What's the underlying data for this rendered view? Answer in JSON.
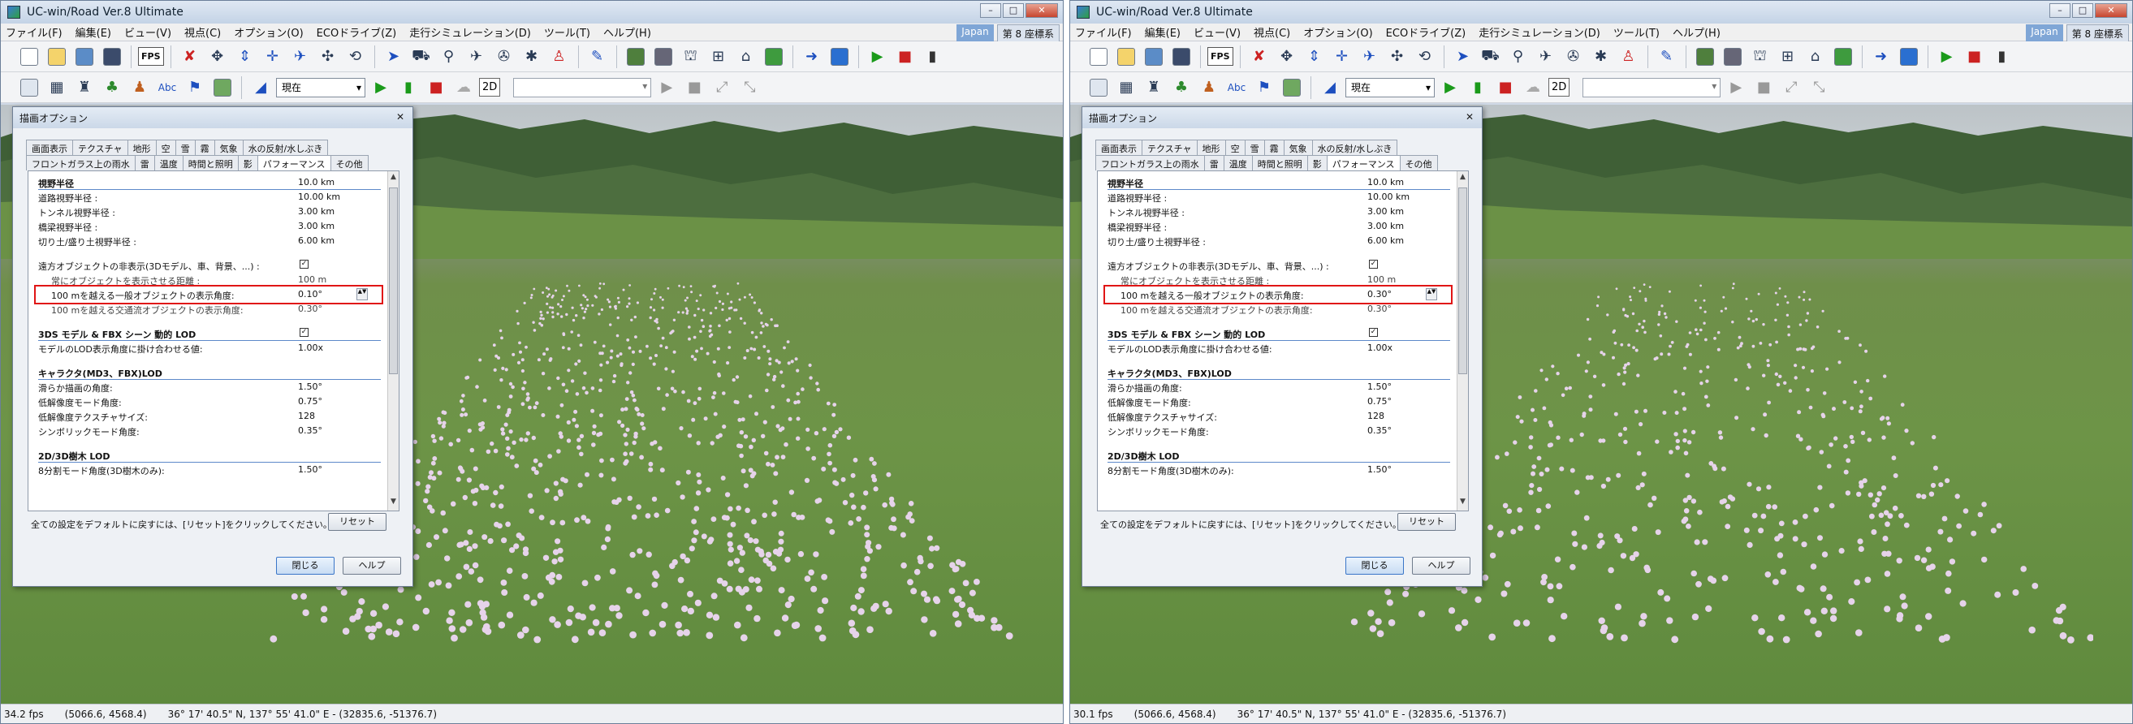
{
  "windows": [
    {
      "id": "left",
      "title": "UC-win/Road Ver.8 Ultimate",
      "menu": [
        "ファイル(F)",
        "編集(E)",
        "ビュー(V)",
        "視点(C)",
        "オプション(O)",
        "ECOドライブ(Z)",
        "走行シミュレーション(D)",
        "ツール(T)",
        "ヘルプ(H)"
      ],
      "badge_japan": "Japan",
      "badge_coord": "第 8 座標系",
      "fps_button": "FPS",
      "time_select": "現在",
      "btn_2d": "2D",
      "dialog": {
        "title": "描画オプション",
        "tabs_row1": [
          "画面表示",
          "テクスチャ",
          "地形",
          "空",
          "雪",
          "霧",
          "気象",
          "水の反射/水しぶき"
        ],
        "tabs_row2": [
          "フロントガラス上の雨水",
          "雷",
          "温度",
          "時間と照明",
          "影",
          "パフォーマンス",
          "その他"
        ],
        "active_tab": "パフォーマンス",
        "rows": [
          {
            "type": "section",
            "label": "視野半径",
            "value": "10.0 km"
          },
          {
            "type": "item",
            "label": "道路視野半径 :",
            "value": "10.00 km"
          },
          {
            "type": "item",
            "label": "トンネル視野半径 :",
            "value": "3.00 km"
          },
          {
            "type": "item",
            "label": "橋梁視野半径 :",
            "value": "3.00 km"
          },
          {
            "type": "item",
            "label": "切り土/盛り土視野半径 :",
            "value": "6.00 km"
          },
          {
            "type": "gap"
          },
          {
            "type": "check",
            "label": "遠方オブジェクトの非表示(3Dモデル、車、背景、...) :",
            "checked": true
          },
          {
            "type": "struck",
            "label": "常にオブジェクトを表示させる距離 :",
            "value": "100  m"
          },
          {
            "type": "highlight",
            "label": "100 mを越える一般オブジェクトの表示角度:",
            "value": "0.10°"
          },
          {
            "type": "struck",
            "label": "100 mを越える交通流オブジェクトの表示角度:",
            "value": "0.30°"
          },
          {
            "type": "gap"
          },
          {
            "type": "check-section",
            "label": "3DS モデル & FBX シーン 動的 LOD",
            "checked": true
          },
          {
            "type": "item",
            "label": "モデルのLOD表示角度に掛け合わせる値:",
            "value": "1.00x"
          },
          {
            "type": "gap"
          },
          {
            "type": "section",
            "label": "キャラクタ(MD3、FBX)LOD",
            "value": ""
          },
          {
            "type": "item",
            "label": "滑らか描画の角度:",
            "value": "1.50°"
          },
          {
            "type": "item",
            "label": "低解像度モード角度:",
            "value": "0.75°"
          },
          {
            "type": "item",
            "label": "低解像度テクスチャサイズ:",
            "value": "128"
          },
          {
            "type": "item",
            "label": "シンボリックモード角度:",
            "value": "0.35°"
          },
          {
            "type": "gap"
          },
          {
            "type": "section",
            "label": "2D/3D樹木 LOD",
            "value": ""
          },
          {
            "type": "item",
            "label": "8分割モード角度(3D樹木のみ):",
            "value": "1.50°"
          }
        ],
        "reset_text": "全ての設定をデフォルトに戻すには、[リセット]をクリックしてください。",
        "reset_button": "リセット",
        "close_button": "閉じる",
        "help_button": "ヘルプ"
      },
      "status": {
        "fps": "34.2 fps",
        "pos": "(5066.6, 4568.4)",
        "geo": "36°  17' 40.5\" N, 137°  55' 41.0\" E - (32835.6, -51376.7)"
      }
    },
    {
      "id": "right",
      "title": "UC-win/Road Ver.8 Ultimate",
      "menu": [
        "ファイル(F)",
        "編集(E)",
        "ビュー(V)",
        "視点(C)",
        "オプション(O)",
        "ECOドライブ(Z)",
        "走行シミュレーション(D)",
        "ツール(T)",
        "ヘルプ(H)"
      ],
      "badge_japan": "Japan",
      "badge_coord": "第 8 座標系",
      "fps_button": "FPS",
      "time_select": "現在",
      "btn_2d": "2D",
      "dialog": {
        "title": "描画オプション",
        "tabs_row1": [
          "画面表示",
          "テクスチャ",
          "地形",
          "空",
          "雪",
          "霧",
          "気象",
          "水の反射/水しぶき"
        ],
        "tabs_row2": [
          "フロントガラス上の雨水",
          "雷",
          "温度",
          "時間と照明",
          "影",
          "パフォーマンス",
          "その他"
        ],
        "active_tab": "パフォーマンス",
        "rows": [
          {
            "type": "section",
            "label": "視野半径",
            "value": "10.0 km"
          },
          {
            "type": "item",
            "label": "道路視野半径 :",
            "value": "10.00 km"
          },
          {
            "type": "item",
            "label": "トンネル視野半径 :",
            "value": "3.00 km"
          },
          {
            "type": "item",
            "label": "橋梁視野半径 :",
            "value": "3.00 km"
          },
          {
            "type": "item",
            "label": "切り土/盛り土視野半径 :",
            "value": "6.00 km"
          },
          {
            "type": "gap"
          },
          {
            "type": "check",
            "label": "遠方オブジェクトの非表示(3Dモデル、車、背景、...) :",
            "checked": true
          },
          {
            "type": "struck",
            "label": "常にオブジェクトを表示させる距離 :",
            "value": "100  m"
          },
          {
            "type": "highlight",
            "label": "100 mを越える一般オブジェクトの表示角度:",
            "value": "0.30°"
          },
          {
            "type": "struck",
            "label": "100 mを越える交通流オブジェクトの表示角度:",
            "value": "0.30°"
          },
          {
            "type": "gap"
          },
          {
            "type": "check-section",
            "label": "3DS モデル & FBX シーン 動的 LOD",
            "checked": true
          },
          {
            "type": "item",
            "label": "モデルのLOD表示角度に掛け合わせる値:",
            "value": "1.00x"
          },
          {
            "type": "gap"
          },
          {
            "type": "section",
            "label": "キャラクタ(MD3、FBX)LOD",
            "value": ""
          },
          {
            "type": "item",
            "label": "滑らか描画の角度:",
            "value": "1.50°"
          },
          {
            "type": "item",
            "label": "低解像度モード角度:",
            "value": "0.75°"
          },
          {
            "type": "item",
            "label": "低解像度テクスチャサイズ:",
            "value": "128"
          },
          {
            "type": "item",
            "label": "シンボリックモード角度:",
            "value": "0.35°"
          },
          {
            "type": "gap"
          },
          {
            "type": "section",
            "label": "2D/3D樹木 LOD",
            "value": ""
          },
          {
            "type": "item",
            "label": "8分割モード角度(3D樹木のみ):",
            "value": "1.50°"
          }
        ],
        "reset_text": "全ての設定をデフォルトに戻すには、[リセット]をクリックしてください。",
        "reset_button": "リセット",
        "close_button": "閉じる",
        "help_button": "ヘルプ"
      },
      "status": {
        "fps": "30.1 fps",
        "pos": "(5066.6, 4568.4)",
        "geo": "36°  17' 40.5\" N, 137°  55' 41.0\" E - (32835.6, -51376.7)"
      }
    }
  ],
  "colors": {
    "highlight_border": "#e01515",
    "section_rule": "#5d89c9",
    "grass": "#6d9447",
    "flower": "#e6d3ea"
  }
}
